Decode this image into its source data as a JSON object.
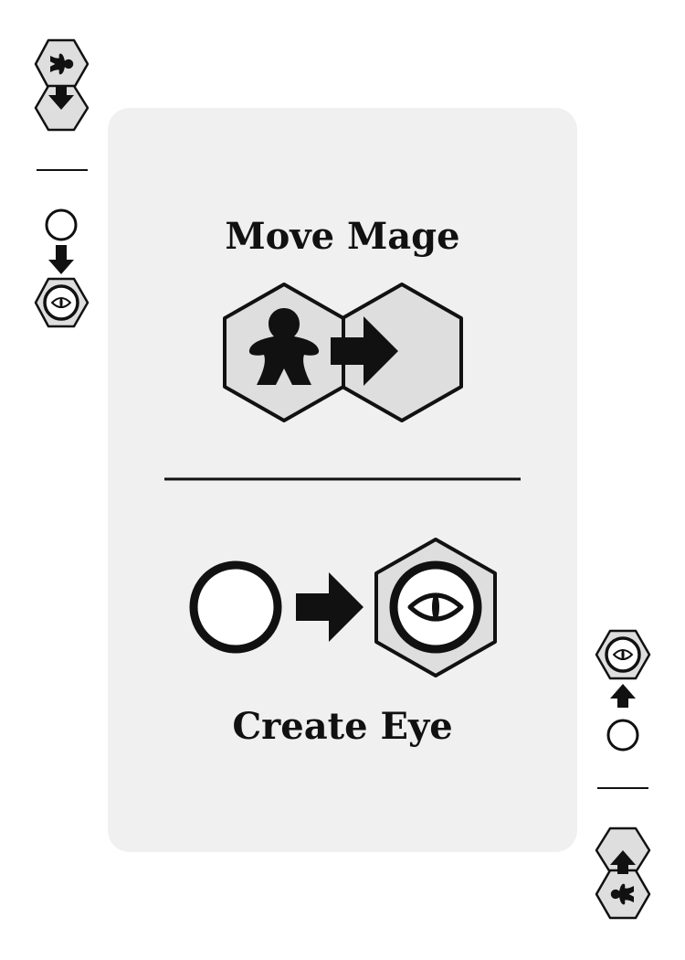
{
  "card": {
    "top_action": {
      "title": "Move Mage",
      "icons": [
        "hex-tile-icon",
        "mage-meeple-icon",
        "right-arrow-icon",
        "hex-tile-icon"
      ]
    },
    "bottom_action": {
      "title": "Create Eye",
      "icons": [
        "empty-circle-icon",
        "right-arrow-icon",
        "eye-hex-icon"
      ]
    },
    "corner_icons": {
      "top_left": [
        "mage-meeple-icon",
        "down-arrow-icon",
        "empty-circle-icon",
        "eye-hex-icon"
      ],
      "bottom_right": [
        "eye-hex-icon",
        "up-arrow-icon",
        "empty-circle-icon",
        "mage-meeple-icon"
      ]
    },
    "colors": {
      "panel": "#f0f0f0",
      "hex_fill": "#dedede",
      "ink": "#111111",
      "white": "#ffffff"
    }
  }
}
